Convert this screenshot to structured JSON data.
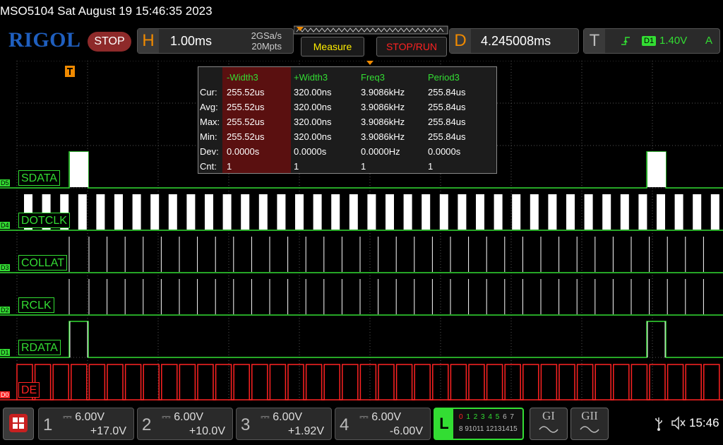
{
  "title": "MSO5104  Sat August 19 15:46:35 2023",
  "header": {
    "logo": "RIGOL",
    "run_state": "STOP",
    "horizontal": {
      "key": "H",
      "timebase": "1.00ms",
      "sample_rate": "2GSa/s",
      "memory_depth": "20Mpts"
    },
    "measure_label": "Measure",
    "stoprun_label": "STOP/RUN",
    "delay": {
      "key": "D",
      "value": "4.245008ms"
    },
    "trigger": {
      "key": "T",
      "source": "D1",
      "level": "1.40V",
      "mode": "A"
    }
  },
  "measurement": {
    "headers": [
      "-Width3",
      "+Width3",
      "Freq3",
      "Period3"
    ],
    "rows": [
      {
        "label": "Cur:",
        "values": [
          "255.52us",
          "320.00ns",
          "3.9086kHz",
          "255.84us"
        ]
      },
      {
        "label": "Avg:",
        "values": [
          "255.52us",
          "320.00ns",
          "3.9086kHz",
          "255.84us"
        ]
      },
      {
        "label": "Max:",
        "values": [
          "255.52us",
          "320.00ns",
          "3.9086kHz",
          "255.84us"
        ]
      },
      {
        "label": "Min:",
        "values": [
          "255.52us",
          "320.00ns",
          "3.9086kHz",
          "255.84us"
        ]
      },
      {
        "label": "Dev:",
        "values": [
          "0.0000s",
          "0.0000s",
          "0.0000Hz",
          "0.0000s"
        ]
      },
      {
        "label": "Cnt:",
        "values": [
          "1",
          "1",
          "1",
          "1"
        ]
      }
    ]
  },
  "channels": {
    "d5": {
      "tag": "D5",
      "label": "SDATA"
    },
    "d4": {
      "tag": "D4",
      "label": "DOTCLK"
    },
    "d3": {
      "tag": "D3",
      "label": "COLLAT"
    },
    "d2": {
      "tag": "D2",
      "label": "RCLK"
    },
    "d1": {
      "tag": "D1",
      "label": "RDATA"
    },
    "d0": {
      "tag": "D0",
      "label": "DE"
    }
  },
  "analog": [
    {
      "num": "1",
      "scale": "6.00V",
      "offset": "+17.0V"
    },
    {
      "num": "2",
      "scale": "6.00V",
      "offset": "+10.0V"
    },
    {
      "num": "3",
      "scale": "6.00V",
      "offset": "+1.92V"
    },
    {
      "num": "4",
      "scale": "6.00V",
      "offset": "-6.00V"
    }
  ],
  "logic": {
    "key": "L",
    "row1": [
      "0",
      "1",
      "2",
      "3",
      "4",
      "5",
      "6",
      "7"
    ],
    "row2": [
      "8",
      "9",
      "10",
      "11",
      "12",
      "13",
      "14",
      "15"
    ]
  },
  "bus_buttons": [
    "GI",
    "GII"
  ],
  "status": {
    "time": "15:46"
  },
  "colors": {
    "logic_green": "#33dd33",
    "d0_red": "#ff2222",
    "accent_orange": "#f08a00",
    "brand_blue": "#1f5fbf"
  }
}
